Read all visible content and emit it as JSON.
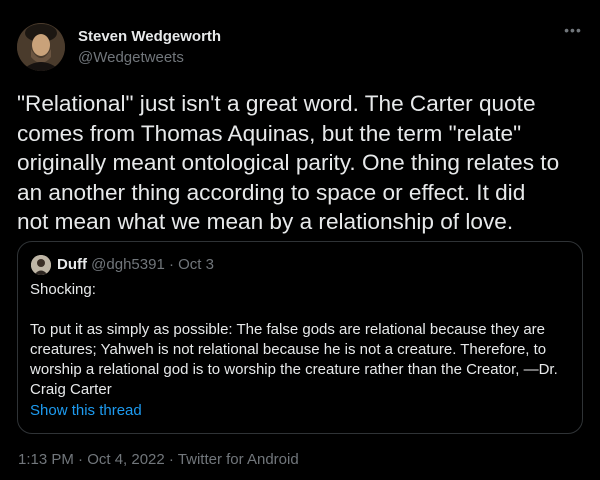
{
  "author": {
    "name": "Steven Wedgeworth",
    "handle": "@Wedgetweets",
    "avatar_icon": "profile-portrait-icon"
  },
  "more_icon": "ellipsis-icon",
  "tweet": {
    "lines": [
      "\"Relational\" just isn't a great word. The Carter quote",
      "comes from Thomas Aquinas, but the term \"relate\"",
      "originally meant ontological parity. One thing relates to",
      "an another thing according to space or effect. It did",
      "not mean what we mean by a relationship of love."
    ]
  },
  "quoted_tweet": {
    "name": "Duff",
    "meta": "@dgh5391 · Oct 3",
    "avatar_icon": "profile-avatar-icon",
    "body_first": "Shocking:",
    "body_lines": [
      "To put it as simply as possible: The false gods are relational because they are",
      "creatures; Yahweh is not relational because he is not a creature. Therefore, to",
      "worship a relational god is to worship the creature rather than the Creator, —Dr.",
      "Craig Carter"
    ],
    "show_thread": "Show this thread"
  },
  "timestamp": "1:13 PM · Oct 4, 2022 · Twitter for Android",
  "colors": {
    "background": "#000000",
    "text": "#e7e9ea",
    "secondary": "#71767b",
    "link": "#1d9bf0",
    "border": "#2f3336"
  }
}
